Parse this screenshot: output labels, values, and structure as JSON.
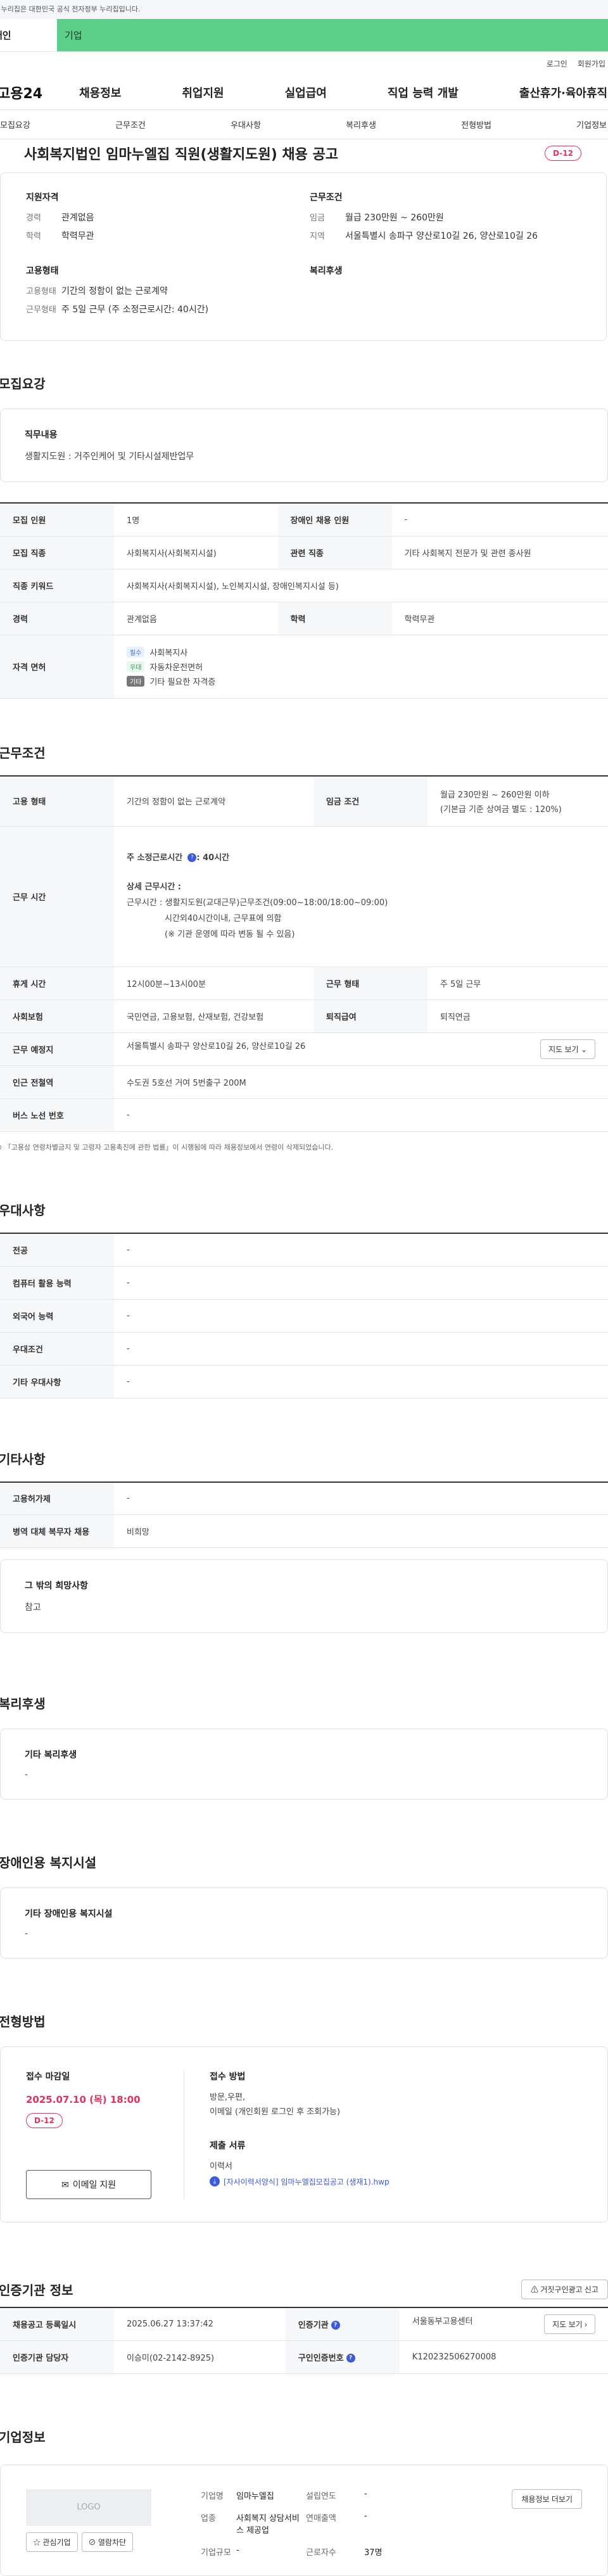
{
  "banner": "이 누리집은 대한민국 공식 전자정부 누리집입니다.",
  "user_tabs": {
    "personal": "개인",
    "company": "기업"
  },
  "util": {
    "login": "로그인",
    "signup": "회원가입"
  },
  "gnb": {
    "logo": "고용24",
    "menus": [
      "채용정보",
      "취업지원",
      "실업급여",
      "직업 능력 개발",
      "출산휴가·육아휴직"
    ]
  },
  "sub_tabs": [
    "모집요강",
    "근무조건",
    "우대사항",
    "복리후생",
    "전형방법",
    "기업정보"
  ],
  "title": "사회복지법인 임마누엘집 직원(생활지도원) 채용 공고",
  "dday": "D-12",
  "summary": {
    "qual": {
      "title": "지원자격",
      "rows": [
        {
          "k": "경력",
          "v": "관계없음"
        },
        {
          "k": "학력",
          "v": "학력무관"
        }
      ]
    },
    "cond": {
      "title": "근무조건",
      "rows": [
        {
          "k": "임금",
          "v": "월급 230만원 ~ 260만원"
        },
        {
          "k": "지역",
          "v": "서울특별시 송파구 양산로10길 26, 양산로10길 26"
        }
      ]
    },
    "type": {
      "title": "고용형태",
      "rows": [
        {
          "k": "고용형태",
          "v": "기간의 정함이 없는 근로계약"
        },
        {
          "k": "근무형태",
          "v": "주 5일 근무 (주 소정근로시간: 40시간)"
        }
      ]
    },
    "welfare": {
      "title": "복리후생"
    }
  },
  "recruit": {
    "section": "모집요강",
    "duty_title": "직무내용",
    "duty": "생활지도원 : 거주인케어 및 기타시설제반업무",
    "rows": {
      "count_k": "모집 인원",
      "count_v": "1명",
      "dis_k": "장애인 채용 인원",
      "dis_v": "-",
      "job_k": "모집 직종",
      "job_v": "사회복지사(사회복지시설)",
      "rel_k": "관련 직종",
      "rel_v": "기타 사회복지 전문가 및 관련 종사원",
      "kw_k": "직종 키워드",
      "kw_v": "사회복지사(사회복지시설), 노인복지시설, 장애인복지시설 등)",
      "career_k": "경력",
      "career_v": "관계없음",
      "edu_k": "학력",
      "edu_v": "학력무관",
      "lic_k": "자격 면허",
      "licenses": [
        {
          "tag": "필수",
          "name": "사회복지사"
        },
        {
          "tag": "우대",
          "name": "자동차운전면허"
        },
        {
          "tag": "기타",
          "name": "기타 필요한 자격증"
        }
      ]
    }
  },
  "work": {
    "section": "근무조건",
    "emp_k": "고용 형태",
    "emp_v": "기간의 정함이 없는 근로계약",
    "wage_k": "임금 조건",
    "wage_v1": "월급 230만원 ~ 260만원 이하",
    "wage_v2": "(기본급 기준 상여금 별도 : 120%)",
    "time_k": "근무 시간",
    "time_head": "주 소정근로시간",
    "time_hours": ": 40시간",
    "time_detail_title": "상세 근무시간 :",
    "time_detail_1": "근무시간 : 생활지도원(교대근무)근무조건(09:00~18:00/18:00~09:00)",
    "time_detail_2": "시간외40시간이내, 근무표에 의함",
    "time_detail_3": "(※ 기관 운영에 따라 변동 될 수 있음)",
    "break_k": "휴게 시간",
    "break_v": "12시00분~13시00분",
    "form_k": "근무 형태",
    "form_v": "주 5일 근무",
    "ins_k": "사회보험",
    "ins_v": "국민연금, 고용보험, 산재보험, 건강보험",
    "ret_k": "퇴직급여",
    "ret_v": "퇴직연금",
    "place_k": "근무 예정지",
    "place_v": "서울특별시 송파구 양산로10길 26, 양산로10길 26",
    "map_btn": "지도 보기",
    "sub_k": "인근 전철역",
    "sub_v": "수도권 5호선 거여 5번출구 200M",
    "bus_k": "버스 노선 번호",
    "bus_v": "-",
    "note": "※ 「고용상 연령차별금지 및 고령자 고용촉진에 관한 법률」이 시행됨에 따라 채용정보에서 연령이 삭제되었습니다."
  },
  "pref": {
    "section": "우대사항",
    "rows": [
      {
        "k": "전공",
        "v": "-"
      },
      {
        "k": "컴퓨터 활용 능력",
        "v": "-"
      },
      {
        "k": "외국어 능력",
        "v": "-"
      },
      {
        "k": "우대조건",
        "v": "-"
      },
      {
        "k": "기타 우대사항",
        "v": "-"
      }
    ]
  },
  "etc": {
    "section": "기타사항",
    "rows": [
      {
        "k": "고용허가제",
        "v": "-"
      },
      {
        "k": "병역 대체 복무자 채용",
        "v": "비희망"
      }
    ],
    "hope_title": "그 밖의 희망사항",
    "hope": "참고"
  },
  "welfare": {
    "section": "복리후생",
    "title": "기타 복리후생",
    "value": "-"
  },
  "disability": {
    "section": "장애인용 복지시설",
    "title": "기타 장애인용 복지시설",
    "value": "-"
  },
  "apply": {
    "section": "전형방법",
    "deadline_title": "접수 마감일",
    "deadline": "2025.07.10 (목) 18:00",
    "dday": "D-12",
    "email_btn": "이메일 지원",
    "method_title": "접수 방법",
    "method_1": "방문,우편,",
    "method_2": "이메일 (개인회원 로그인 후 조회가능)",
    "docs_title": "제출 서류",
    "docs": "이력서",
    "attach": "[자사이력서양식] 임마누엘집모집공고 (생재1).hwp"
  },
  "agency": {
    "section": "인증기관 정보",
    "report_btn": "거짓구인광고 신고",
    "reg_k": "채용공고 등록일시",
    "reg_v": "2025.06.27 13:37:42",
    "org_k": "인증기관",
    "org_v": "서울동부고용센터",
    "map_btn": "지도 보기",
    "mgr_k": "인증기관 담당자",
    "mgr_v": "이승미(02-2142-8925)",
    "no_k": "구인인증번호",
    "no_v": "K120232506270008"
  },
  "company": {
    "section": "기업정보",
    "logo": "LOGO",
    "fav_btn": "관심기업",
    "block_btn": "열람차단",
    "name_k": "기업명",
    "name_v": "임마누엘집",
    "biz_k": "업종",
    "biz_v": "사회복지 상담서비스 제공업",
    "size_k": "기업규모",
    "size_v": "-",
    "year_k": "설립연도",
    "year_v": "-",
    "sales_k": "연매출액",
    "sales_v": "-",
    "emp_k": "근로자수",
    "emp_v": "37명",
    "jobs_btn": "채용정보 더보기"
  }
}
